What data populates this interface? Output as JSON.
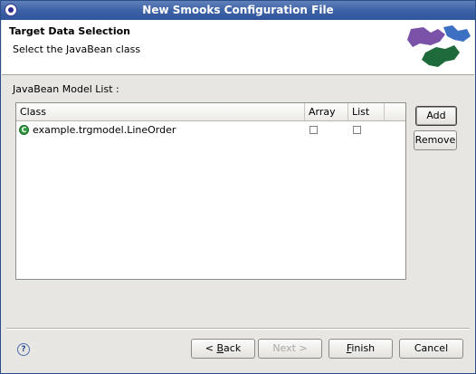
{
  "window": {
    "title": "New Smooks Configuration File",
    "icon": "eclipse-icon"
  },
  "banner": {
    "heading": "Target Data Selection",
    "description": "Select the JavaBean class",
    "image": "smooks-logo-icon",
    "colors": {
      "purple": "#7a52a8",
      "blue": "#3d6fc2",
      "green": "#1e6a3a"
    }
  },
  "model_list": {
    "label": "JavaBean Model List :",
    "columns": [
      "Class",
      "Array",
      "List"
    ],
    "rows": [
      {
        "class": "example.trgmodel.LineOrder",
        "array": false,
        "list": false,
        "icon": "class-icon"
      }
    ]
  },
  "side_buttons": {
    "add": "Add",
    "remove": "Remove"
  },
  "footer": {
    "help_icon": "help-icon",
    "back": {
      "prefix": "< ",
      "mnemonic": "B",
      "rest": "ack"
    },
    "next": {
      "label": "Next >",
      "enabled": false
    },
    "finish": {
      "mnemonic": "F",
      "rest": "inish"
    },
    "cancel": "Cancel"
  }
}
